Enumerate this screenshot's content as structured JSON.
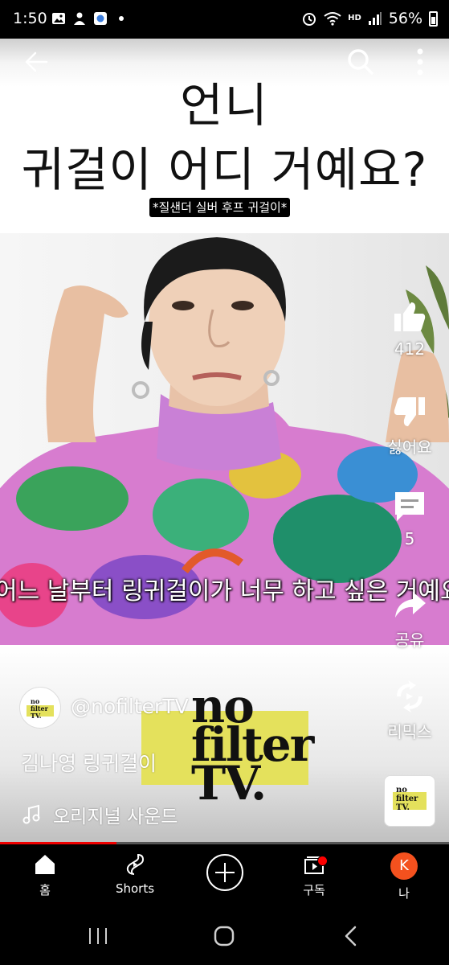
{
  "status_bar": {
    "time": "1:50",
    "battery_percent": "56%",
    "battery_level": 0.56,
    "net_label": "HD"
  },
  "video": {
    "headline_line1": "언니",
    "headline_line2": "귀걸이 어디 거예요?",
    "tag": "*질샌더 실버 후프 귀걸이*",
    "subtitle": "어느 날부터 링귀걸이가 너무 하고 싶은 거예요",
    "logo_lines": [
      "no",
      "filter",
      "TV."
    ],
    "progress": 0.26
  },
  "actions": {
    "like_count": "412",
    "dislike_label": "싫어요",
    "comment_count": "5",
    "share_label": "공유",
    "remix_label": "리믹스"
  },
  "channel": {
    "handle": "@nofilterTV",
    "avatar_text": "no filter TV."
  },
  "short_title": "김나영 링귀걸이",
  "sound": {
    "label": "오리지널 사운드"
  },
  "bottom_nav": {
    "home": "홈",
    "shorts": "Shorts",
    "subscriptions": "구독",
    "you": "나",
    "you_avatar_letter": "K"
  },
  "colors": {
    "accent": "#ff0000",
    "logo_yellow": "#e4e15c",
    "avatar_orange": "#f4511e"
  }
}
